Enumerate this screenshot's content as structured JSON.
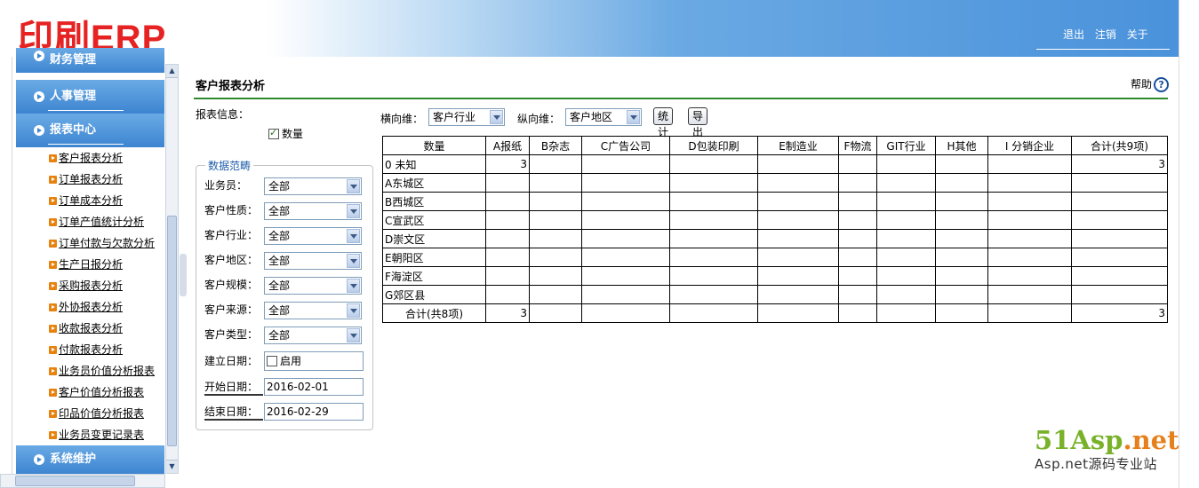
{
  "app": {
    "logo": "印刷ERP",
    "header_links": [
      "退出",
      "注销",
      "关于"
    ]
  },
  "sidebar": {
    "sections": [
      {
        "label": "财务管理"
      },
      {
        "label": "人事管理"
      },
      {
        "label": "报表中心"
      },
      {
        "label": "系统维护"
      }
    ],
    "items": [
      "客户报表分析",
      "订单报表分析",
      "订单成本分析",
      "订单产值统计分析",
      "订单付款与欠款分析",
      "生产日报分析",
      "采购报表分析",
      "外协报表分析",
      "收款报表分析",
      "付款报表分析",
      "业务员价值分析报表",
      "客户价值分析报表",
      "印品价值分析报表",
      "业务员变更记录表"
    ]
  },
  "main": {
    "title": "客户报表分析",
    "help_label": "帮助",
    "info_label": "报表信息：",
    "qty_label": "数量",
    "qty_checked": true,
    "range_legend": "数据范畴",
    "filters": [
      {
        "label": "业务员：",
        "value": "全部"
      },
      {
        "label": "客户性质：",
        "value": "全部"
      },
      {
        "label": "客户行业：",
        "value": "全部"
      },
      {
        "label": "客户地区：",
        "value": "全部"
      },
      {
        "label": "客户规模：",
        "value": "全部"
      },
      {
        "label": "客户来源：",
        "value": "全部"
      },
      {
        "label": "客户类型：",
        "value": "全部"
      }
    ],
    "created_date": {
      "label": "建立日期：",
      "enable_label": "启用",
      "checked": false
    },
    "start_date": {
      "label": "开始日期：",
      "value": "2016-02-01"
    },
    "end_date": {
      "label": "结束日期：",
      "value": "2016-02-29"
    },
    "toolbar": {
      "h_label": "横向维：",
      "h_value": "客户行业",
      "v_label": "纵向维：",
      "v_value": "客户地区",
      "stat_button": "统计",
      "export_button": "导出"
    },
    "table": {
      "headers": [
        "数量",
        "A报纸",
        "B杂志",
        "C广告公司",
        "D包装印刷",
        "E制造业",
        "F物流",
        "GIT行业",
        "H其他",
        "I 分销企业",
        "合计(共9项)"
      ],
      "rows": [
        [
          "0 未知",
          "3",
          "",
          "",
          "",
          "",
          "",
          "",
          "",
          "",
          "3"
        ],
        [
          "A东城区",
          "",
          "",
          "",
          "",
          "",
          "",
          "",
          "",
          "",
          ""
        ],
        [
          "B西城区",
          "",
          "",
          "",
          "",
          "",
          "",
          "",
          "",
          "",
          ""
        ],
        [
          "C宣武区",
          "",
          "",
          "",
          "",
          "",
          "",
          "",
          "",
          "",
          ""
        ],
        [
          "D崇文区",
          "",
          "",
          "",
          "",
          "",
          "",
          "",
          "",
          "",
          ""
        ],
        [
          "E朝阳区",
          "",
          "",
          "",
          "",
          "",
          "",
          "",
          "",
          "",
          ""
        ],
        [
          "F海淀区",
          "",
          "",
          "",
          "",
          "",
          "",
          "",
          "",
          "",
          ""
        ],
        [
          "G郊区县",
          "",
          "",
          "",
          "",
          "",
          "",
          "",
          "",
          "",
          ""
        ],
        [
          "合计(共8项)",
          "3",
          "",
          "",
          "",
          "",
          "",
          "",
          "",
          "",
          "3"
        ]
      ]
    }
  },
  "watermark": {
    "line1_a": "51Asp",
    "line1_b": ".net",
    "line2": "Asp.net源码专业站"
  }
}
